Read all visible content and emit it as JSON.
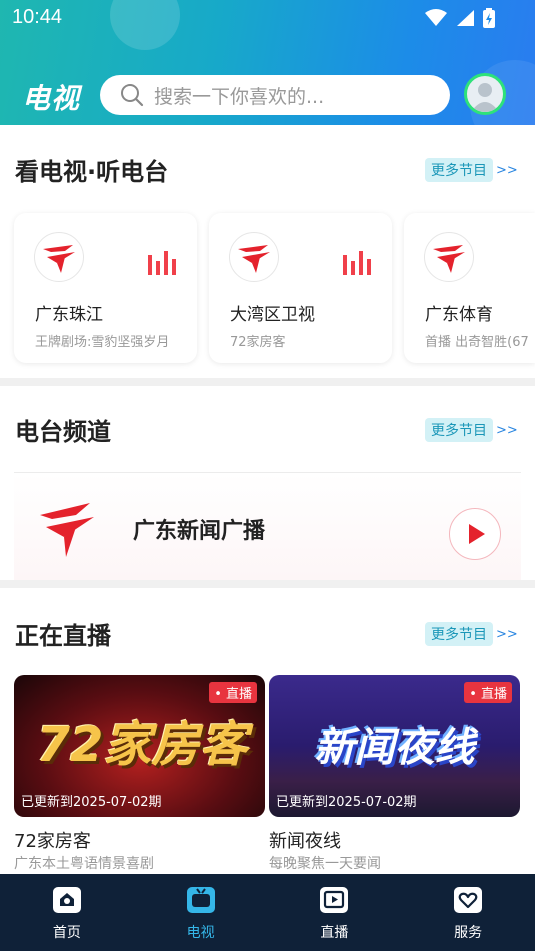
{
  "status_bar": {
    "time": "10:44"
  },
  "header": {
    "logo_text": "电视",
    "search_placeholder": "搜索一下你喜欢的..."
  },
  "section_tv": {
    "title": "看电视·听电台",
    "more_label": "更多节目",
    "more_arrow": ">>",
    "channels": [
      {
        "name": "广东珠江",
        "subtitle": "王牌剧场:雪豹坚强岁月"
      },
      {
        "name": "大湾区卫视",
        "subtitle": "72家房客"
      },
      {
        "name": "广东体育",
        "subtitle": "首播 出奇智胜(67"
      }
    ]
  },
  "section_radio": {
    "title": "电台频道",
    "more_label": "更多节目",
    "more_arrow": ">>",
    "station": {
      "name": "广东新闻广播"
    }
  },
  "section_live": {
    "title": "正在直播",
    "more_label": "更多节目",
    "more_arrow": ">>",
    "items": [
      {
        "badge": "• 直播",
        "thumb_text": "72家房客",
        "update": "已更新到2025-07-02期",
        "title": "72家房客",
        "desc": "广东本土粤语情景喜剧"
      },
      {
        "badge": "• 直播",
        "thumb_text": "新闻夜线",
        "update": "已更新到2025-07-02期",
        "title": "新闻夜线",
        "desc": "每晚聚焦一天要闻"
      }
    ]
  },
  "bottom_nav": {
    "items": [
      {
        "label": "首页",
        "icon": "home-icon",
        "active": false
      },
      {
        "label": "电视",
        "icon": "tv-icon",
        "active": true
      },
      {
        "label": "直播",
        "icon": "live-play-icon",
        "active": false
      },
      {
        "label": "服务",
        "icon": "service-heart-icon",
        "active": false
      }
    ]
  },
  "colors": {
    "header_gradient_start": "#1fb7b0",
    "header_gradient_end": "#2a7cf0",
    "accent_red": "#e8343f",
    "nav_bg": "#0f2138",
    "nav_active": "#35b6e8"
  }
}
